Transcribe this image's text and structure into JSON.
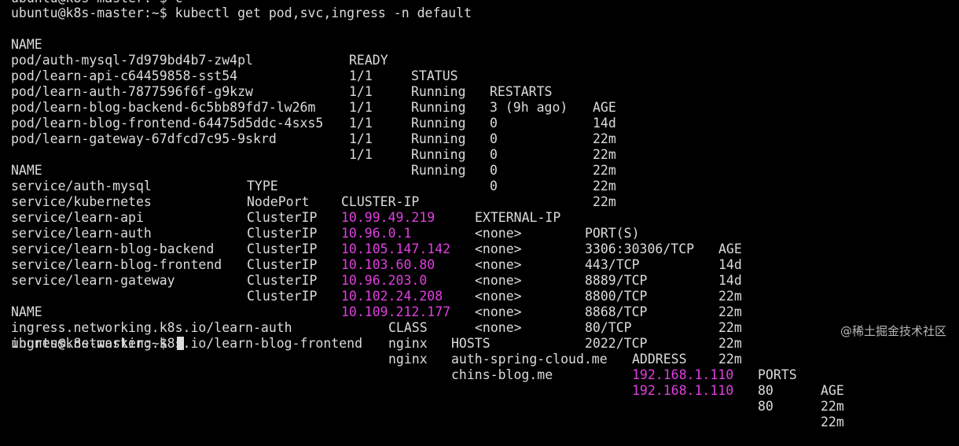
{
  "terminal": {
    "top_partial_line": "ubuntu@k8s-master:~$ c",
    "command_prompt": "ubuntu@k8s-master:~$ ",
    "command": "kubectl get pod,svc,ingress -n default",
    "final_prompt": "ubuntu@k8s-master:~$ "
  },
  "pods": {
    "headers": [
      "NAME",
      "READY",
      "STATUS",
      "RESTARTS",
      "AGE"
    ],
    "rows": [
      [
        "pod/auth-mysql-7d979bd4b7-zw4pl",
        "1/1",
        "Running",
        "3 (9h ago)",
        "14d"
      ],
      [
        "pod/learn-api-c64459858-sst54",
        "1/1",
        "Running",
        "0",
        "22m"
      ],
      [
        "pod/learn-auth-7877596f6f-g9kzw",
        "1/1",
        "Running",
        "0",
        "22m"
      ],
      [
        "pod/learn-blog-backend-6c5bb89fd7-lw26m",
        "1/1",
        "Running",
        "0",
        "22m"
      ],
      [
        "pod/learn-blog-frontend-64475d5ddc-4sxs5",
        "1/1",
        "Running",
        "0",
        "22m"
      ],
      [
        "pod/learn-gateway-67dfcd7c95-9skrd",
        "1/1",
        "Running",
        "0",
        "22m"
      ]
    ]
  },
  "services": {
    "headers": [
      "NAME",
      "TYPE",
      "CLUSTER-IP",
      "EXTERNAL-IP",
      "PORT(S)",
      "AGE"
    ],
    "rows": [
      [
        "service/auth-mysql",
        "NodePort",
        "10.99.49.219",
        "<none>",
        "3306:30306/TCP",
        "14d"
      ],
      [
        "service/kubernetes",
        "ClusterIP",
        "10.96.0.1",
        "<none>",
        "443/TCP",
        "14d"
      ],
      [
        "service/learn-api",
        "ClusterIP",
        "10.105.147.142",
        "<none>",
        "8889/TCP",
        "22m"
      ],
      [
        "service/learn-auth",
        "ClusterIP",
        "10.103.60.80",
        "<none>",
        "8800/TCP",
        "22m"
      ],
      [
        "service/learn-blog-backend",
        "ClusterIP",
        "10.96.203.0",
        "<none>",
        "8868/TCP",
        "22m"
      ],
      [
        "service/learn-blog-frontend",
        "ClusterIP",
        "10.102.24.208",
        "<none>",
        "80/TCP",
        "22m"
      ],
      [
        "service/learn-gateway",
        "ClusterIP",
        "10.109.212.177",
        "<none>",
        "2022/TCP",
        "22m"
      ]
    ]
  },
  "ingresses": {
    "headers": [
      "NAME",
      "CLASS",
      "HOSTS",
      "ADDRESS",
      "PORTS",
      "AGE"
    ],
    "rows": [
      [
        "ingress.networking.k8s.io/learn-auth",
        "nginx",
        "auth-spring-cloud.me",
        "192.168.1.110",
        "80",
        "22m"
      ],
      [
        "ingress.networking.k8s.io/learn-blog-frontend",
        "nginx",
        "chins-blog.me",
        "192.168.1.110",
        "80",
        "22m"
      ]
    ]
  },
  "watermark": "@稀土掘金技术社区",
  "colors": {
    "background": "#000000",
    "text": "#dcdcdc",
    "highlight": "#e040e0"
  }
}
